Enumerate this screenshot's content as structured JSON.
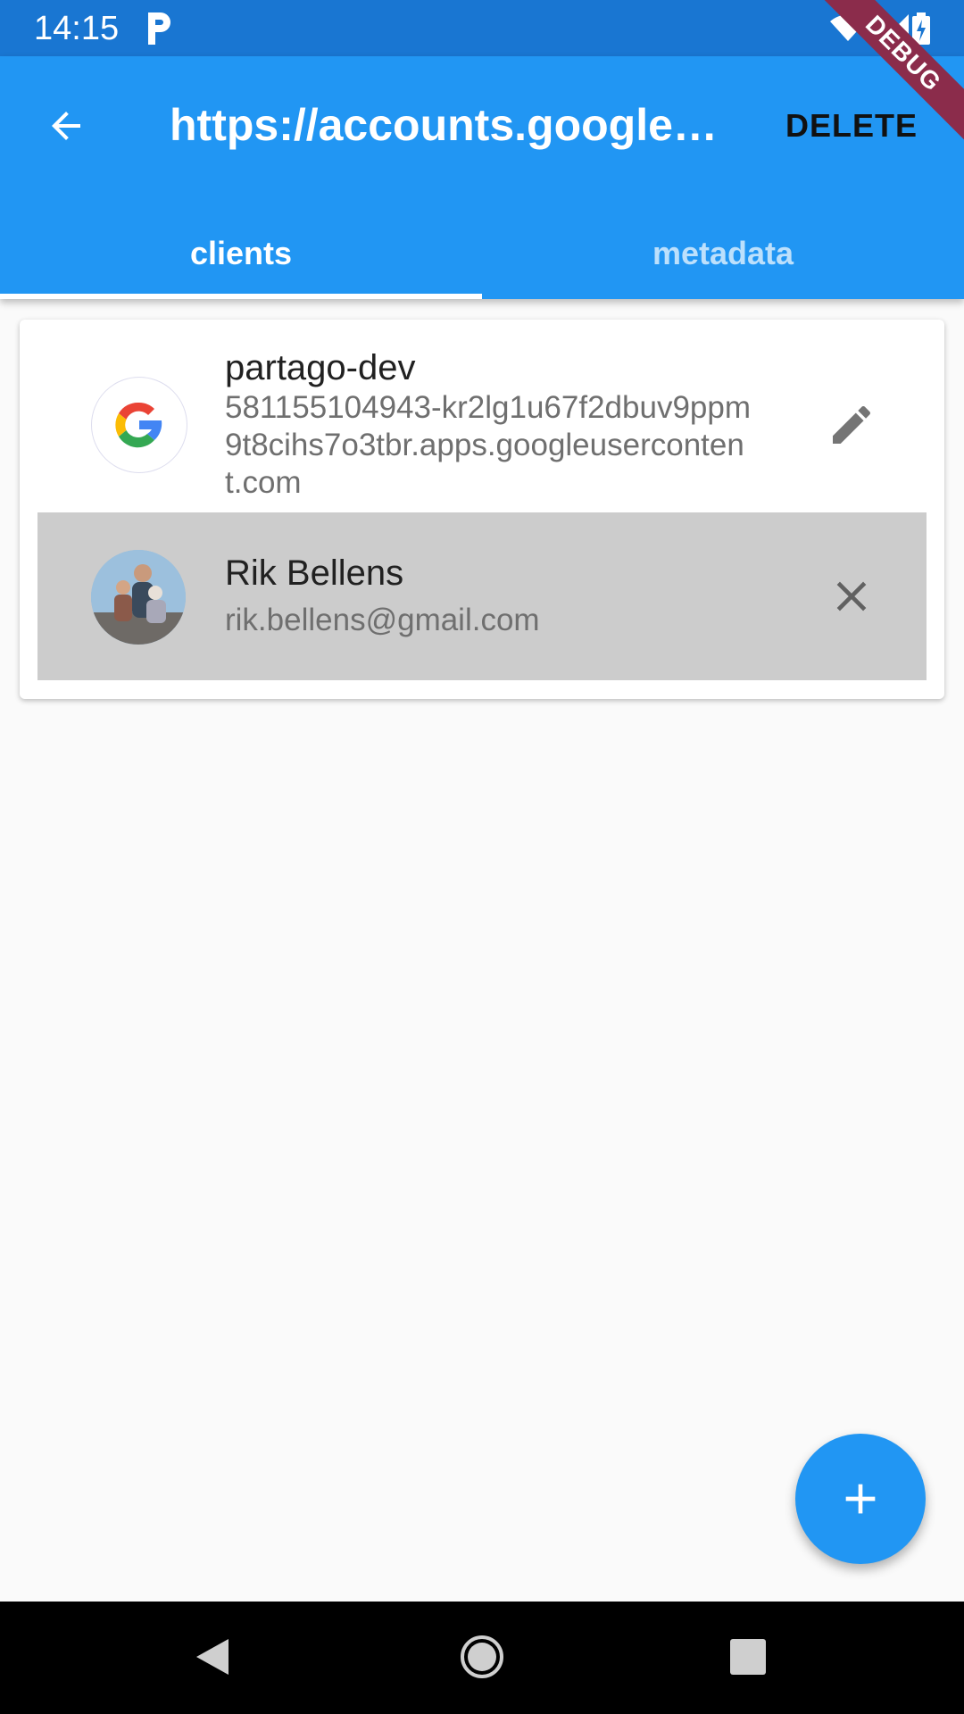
{
  "status_bar": {
    "time": "14:15",
    "icons": [
      "parking-app-icon",
      "wifi-icon",
      "signal-icon",
      "battery-charging-icon"
    ]
  },
  "debug_banner": "DEBUG",
  "app_bar": {
    "title": "https://accounts.google.com",
    "delete_label": "DELETE",
    "tabs": [
      {
        "label": "clients",
        "selected": true
      },
      {
        "label": "metadata",
        "selected": false
      }
    ]
  },
  "client": {
    "name": "partago-dev",
    "id": "581155104943-kr2lg1u67f2dbuv9ppm9t8cihs7o3tbr.apps.googleusercontent.com",
    "icon": "google-logo-icon",
    "action_icon": "edit-icon"
  },
  "user": {
    "name": "Rik Bellens",
    "email": "rik.bellens@gmail.com",
    "action_icon": "close-icon"
  },
  "fab_icon": "add-icon",
  "colors": {
    "primary": "#2196f3",
    "status_bar": "#1976d2",
    "selected_row": "#cccccc"
  }
}
